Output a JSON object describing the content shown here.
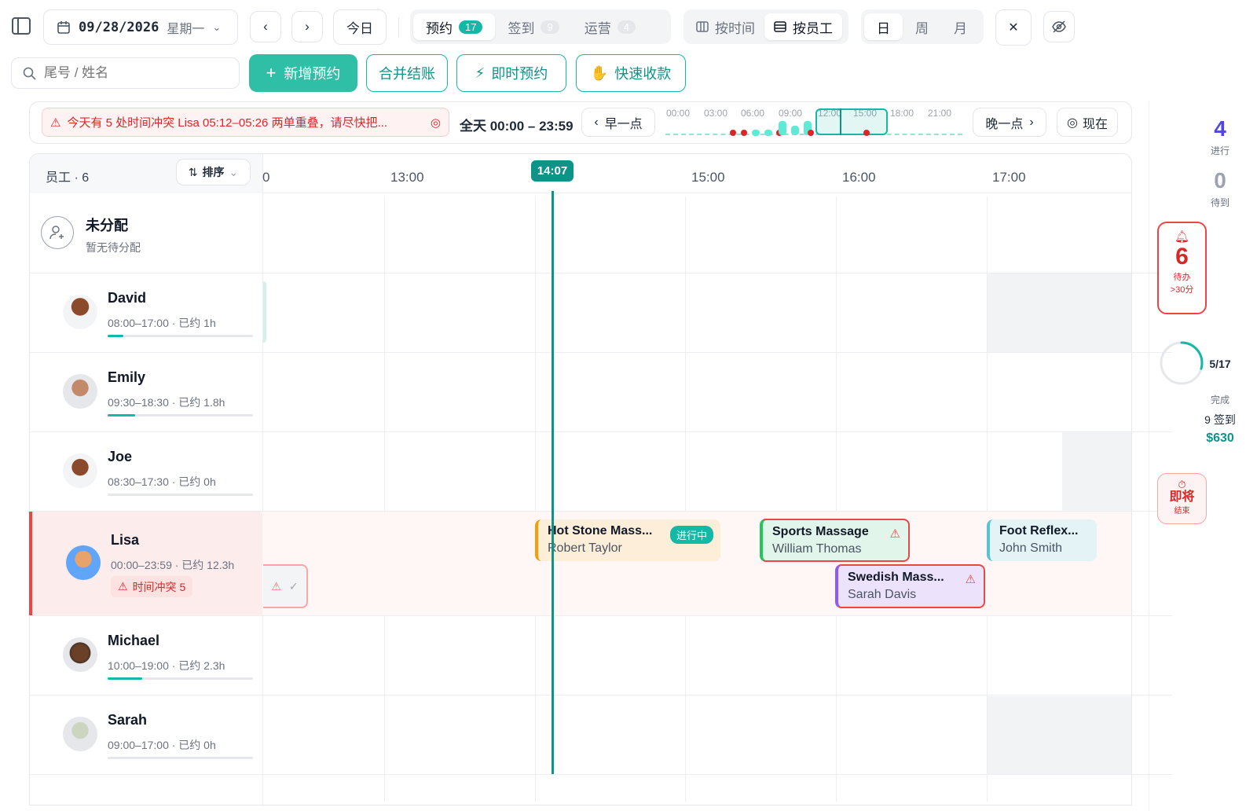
{
  "toolbar": {
    "date": "09/28/2026",
    "weekday": "星期一",
    "today": "今日",
    "tabs": [
      {
        "label": "预约",
        "count": "17"
      },
      {
        "label": "签到",
        "count": "9"
      },
      {
        "label": "运营",
        "count": "4"
      }
    ],
    "view_by_time": "按时间",
    "view_by_staff": "按员工",
    "ranges": [
      "日",
      "周",
      "月"
    ]
  },
  "actions": {
    "search_placeholder": "尾号 / 姓名",
    "new": "新增预约",
    "merge": "合并结账",
    "instant": "即时预约",
    "quick_pay": "快速收款"
  },
  "alert": {
    "text": "今天有 5 处时间冲突 Lisa 05:12–05:26 两单重叠，请尽快把..."
  },
  "timeline": {
    "range_label": "全天 00:00 – 23:59",
    "earlier": "早一点",
    "later": "晚一点",
    "now": "现在",
    "minimap_ticks": [
      "00:00",
      "03:00",
      "06:00",
      "09:00",
      "12:00",
      "15:00",
      "18:00",
      "21:00"
    ]
  },
  "grid": {
    "staff_header": "员工 · 6",
    "sort": "排序",
    "hours": [
      "0",
      "13:00",
      "15:00",
      "16:00",
      "17:00"
    ],
    "now_marker": "14:07"
  },
  "unassigned": {
    "title": "未分配",
    "sub": "暂无待分配"
  },
  "staff": [
    {
      "name": "David",
      "hours": "08:00–17:00 · 已约 1h",
      "progress": 0.11
    },
    {
      "name": "Emily",
      "hours": "09:30–18:30 · 已约 1.8h",
      "progress": 0.19
    },
    {
      "name": "Joe",
      "hours": "08:30–17:30 · 已约 0h",
      "progress": 0
    },
    {
      "name": "Lisa",
      "hours": "00:00–23:59 · 已约 12.3h",
      "conflict": "时间冲突 5"
    },
    {
      "name": "Michael",
      "hours": "10:00–19:00 · 已约 2.3h",
      "progress": 0.24
    },
    {
      "name": "Sarah",
      "hours": "09:00–17:00 · 已约 0h",
      "progress": 0
    }
  ],
  "appointments": [
    {
      "service": "Hot Stone Mass...",
      "client": "Robert Taylor",
      "status": "进行中"
    },
    {
      "service": "Sports Massage",
      "client": "William Thomas"
    },
    {
      "service": "Foot Reflex...",
      "client": "John Smith"
    },
    {
      "service": "Swedish Mass...",
      "client": "Sarah Davis"
    }
  ],
  "sidebar": {
    "in_progress": "4",
    "in_progress_label": "进行",
    "waiting": "0",
    "waiting_label": "待到",
    "pending": "6",
    "pending_label": "待办",
    "pending_sub": ">30分",
    "completed": "5/17",
    "completed_label": "完成",
    "completed_fraction": 0.294,
    "checkin": "9 签到",
    "revenue": "$630",
    "ending_label": "即将",
    "ending_sub": "结束"
  },
  "colors": {
    "teal": "#14b8a6",
    "red": "#dc2626"
  }
}
